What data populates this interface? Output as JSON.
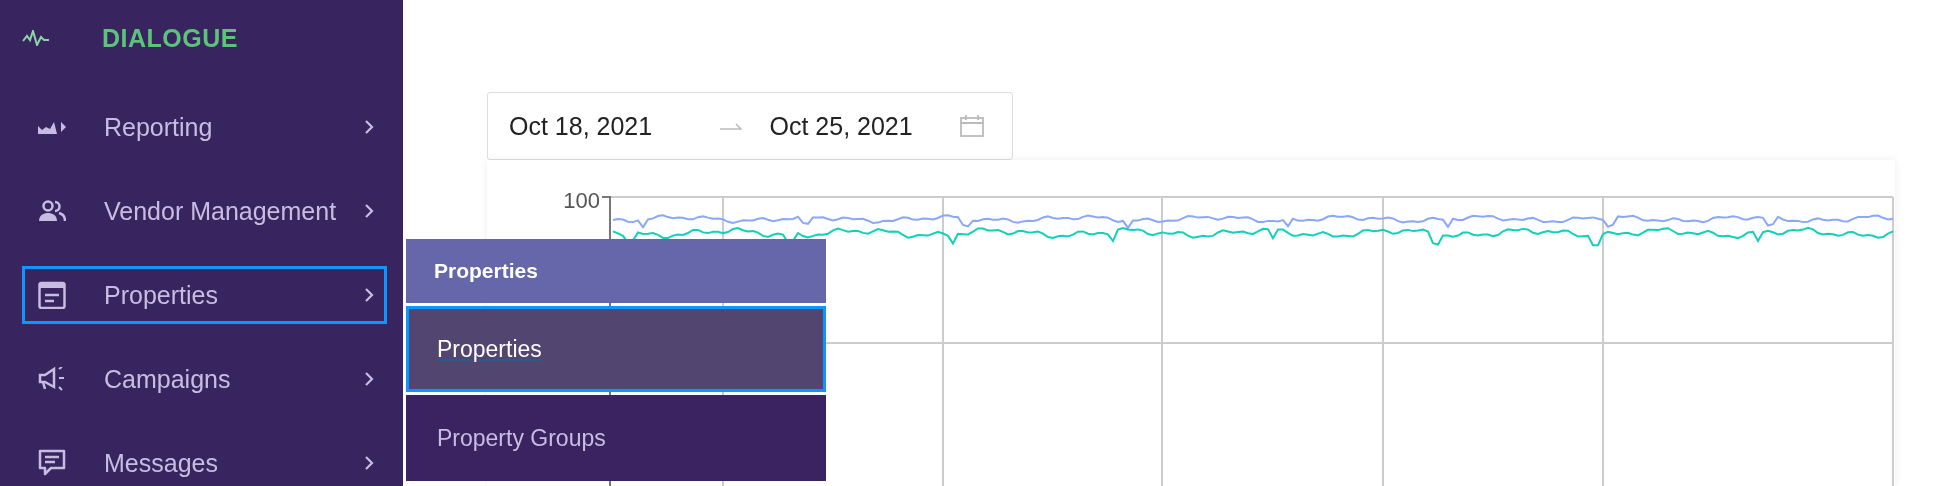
{
  "brand": {
    "name": "DIALOGUE"
  },
  "sidebar": {
    "items": [
      {
        "label": "Reporting",
        "selected": false
      },
      {
        "label": "Vendor Management",
        "selected": false
      },
      {
        "label": "Properties",
        "selected": true
      },
      {
        "label": "Campaigns",
        "selected": false
      },
      {
        "label": "Messages",
        "selected": false
      }
    ]
  },
  "date_range": {
    "start": "Oct 18, 2021",
    "end": "Oct 25, 2021"
  },
  "chart": {
    "y_tick": "100"
  },
  "submenu": {
    "title": "Properties",
    "items": [
      {
        "label": "Properties",
        "selected": true
      },
      {
        "label": "Property Groups",
        "selected": false
      }
    ]
  }
}
